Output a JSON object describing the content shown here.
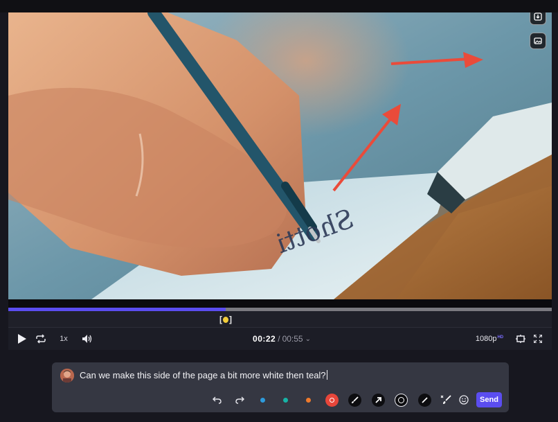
{
  "player": {
    "speed": "1x",
    "current_time": "00:22",
    "time_separator": "/",
    "duration": "00:55",
    "quality": "1080p",
    "quality_badge": "HD",
    "progress_fraction": 0.4
  },
  "video": {
    "handwriting": "Shotti"
  },
  "comment": {
    "text": "Can we make this side of the page a bit more white then teal?",
    "send_label": "Send"
  },
  "annotation_colors": {
    "blue": "#2e9bdc",
    "teal": "#17b3a6",
    "orange": "#ef7a2c",
    "red": "#e7463a",
    "accent": "#5b4df0"
  },
  "icons": {
    "video_buttons": [
      "download-icon",
      "image-icon"
    ],
    "player_controls": [
      "play-icon",
      "loop-icon",
      "volume-icon",
      "safe-zone-icon",
      "fullscreen-icon"
    ],
    "tools": [
      "undo-icon",
      "redo-icon",
      "brush-icon",
      "arrow-icon",
      "rectangle-icon",
      "line-icon",
      "clear-icon",
      "emoji-icon"
    ]
  }
}
